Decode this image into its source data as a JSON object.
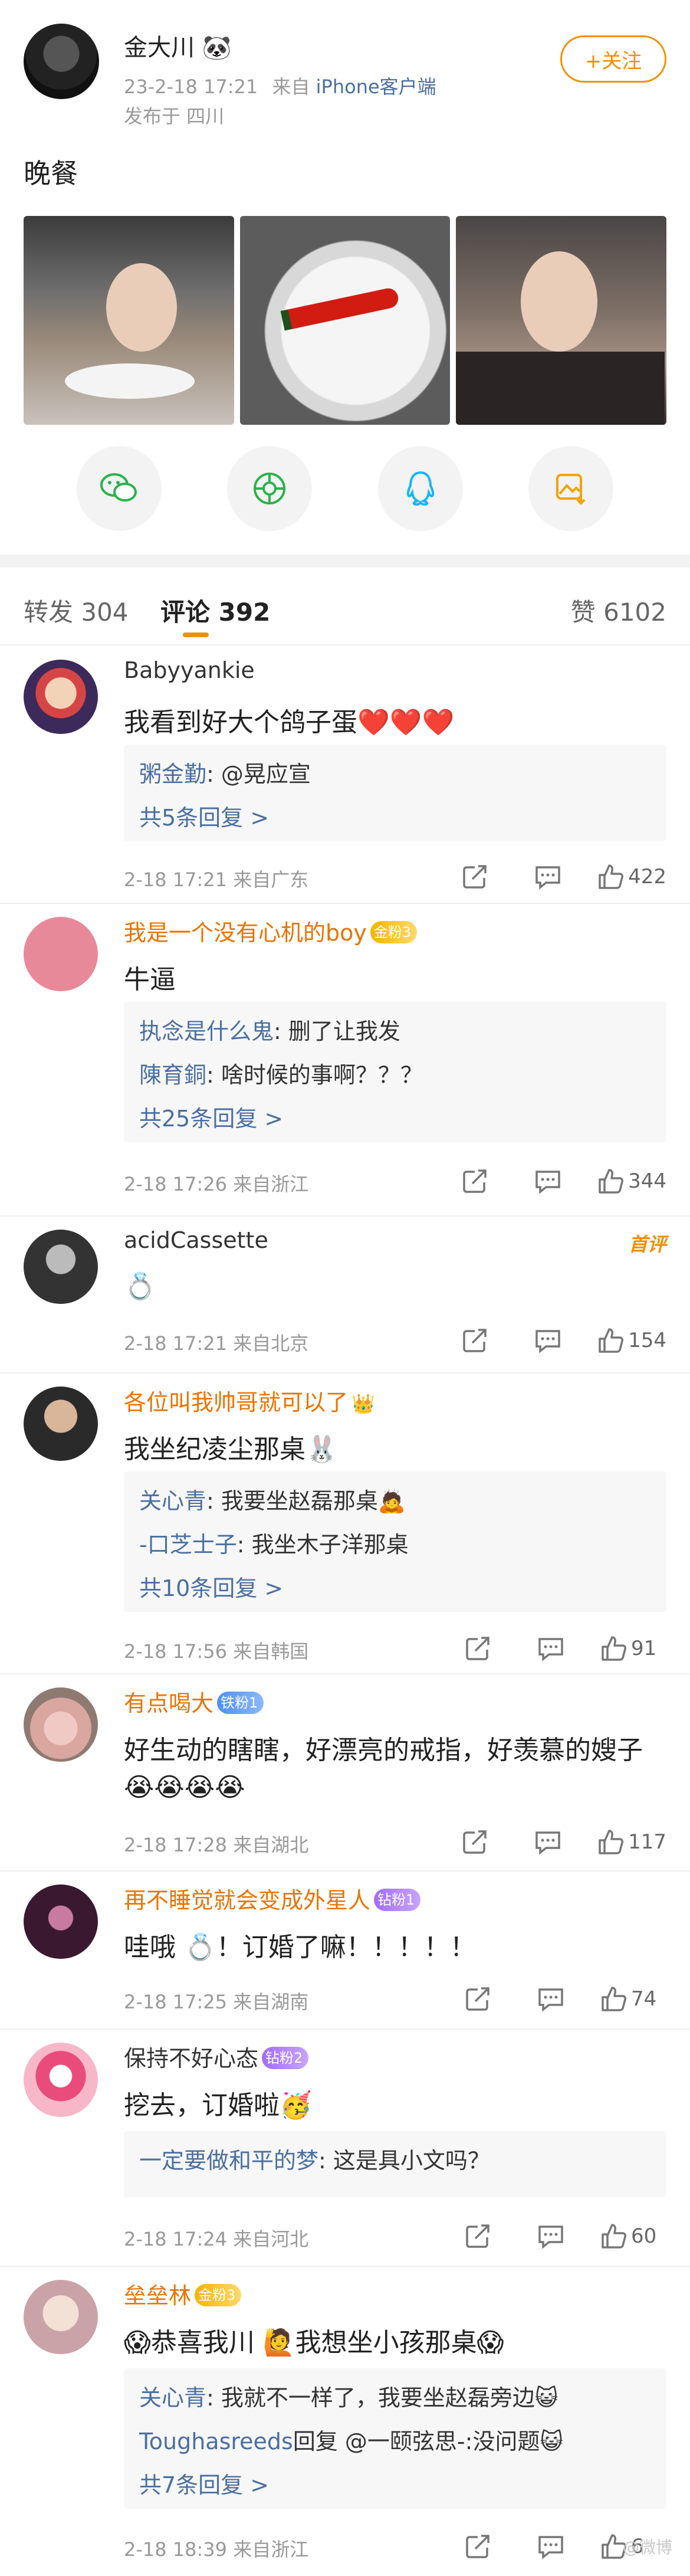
{
  "post": {
    "author_name": "金大川 🐼",
    "date": "23-2-18 17:21",
    "source_prefix": "来自",
    "source": "iPhone客户端",
    "location": "发布于 四川",
    "follow_label": "+关注",
    "text": "晚餐"
  },
  "tabs": {
    "repost": "转发 304",
    "comments": "评论 392",
    "likes": "赞 6102"
  },
  "comments": [
    {
      "name": "Babyyankie",
      "text": "我看到好大个鸽子蛋❤️❤️❤️",
      "replies": [
        {
          "who": "粥金勤",
          "text": ": @晃应宣"
        }
      ],
      "more": "共5条回复 >",
      "time": "2-18 17:21 来自广东",
      "likes": "422"
    },
    {
      "name": "我是一个没有心机的boy",
      "badge": "金粉3",
      "text": "牛逼",
      "replies": [
        {
          "who": "执念是什么鬼",
          "text": ": 删了让我发"
        },
        {
          "who": "陳育銅",
          "text": ": 啥时候的事啊？？？"
        }
      ],
      "more": "共25条回复 >",
      "time": "2-18 17:26 来自浙江",
      "likes": "344"
    },
    {
      "name": "acidCassette",
      "tag": "首评",
      "text": "💍",
      "time": "2-18 17:21 来自北京",
      "likes": "154"
    },
    {
      "name": "各位叫我帅哥就可以了",
      "badge": "👑",
      "text": "我坐纪凌尘那桌🐰",
      "replies": [
        {
          "who": "关心青",
          "text": ": 我要坐赵磊那桌🙇"
        },
        {
          "who": "-口芝士子",
          "text": ": 我坐木子洋那桌"
        }
      ],
      "more": "共10条回复 >",
      "time": "2-18 17:56 来自韩国",
      "likes": "91"
    },
    {
      "name": "有点喝大",
      "badge": "铁粉1",
      "text": "好生动的瞎瞎，好漂亮的戒指，好羡慕的嫂子",
      "text2": "😭😭😭😭",
      "time": "2-18 17:28 来自湖北",
      "likes": "117"
    },
    {
      "name": "再不睡觉就会变成外星人",
      "badge": "钻粉1",
      "text": "哇哦 💍！订婚了嘛！！！！！",
      "time": "2-18 17:25 来自湖南",
      "likes": "74"
    },
    {
      "name": "保持不好心态",
      "badge": "钻粉2",
      "text": "挖去，订婚啦🥳",
      "replies": [
        {
          "who": "一定要做和平的梦",
          "text": ": 这是具小文吗？"
        }
      ],
      "time": "2-18 17:24 来自河北",
      "likes": "60"
    },
    {
      "name": "垒垒林",
      "badge": "金粉3",
      "text": "😱恭喜我川 🙋我想坐小孩那桌😱",
      "replies": [
        {
          "who": "关心青",
          "text": ": 我就不一样了，我要坐赵磊旁边😺"
        },
        {
          "who": "Toughasreeds",
          "text": "回复 @一颐弦思-:没问题😺"
        }
      ],
      "more": "共7条回复 >",
      "time": "2-18 18:39 来自浙江",
      "likes": "6"
    }
  ],
  "icons": {
    "share": [
      "wechat-icon",
      "moments-icon",
      "qq-icon",
      "save-image-icon"
    ],
    "actions": [
      "forward-icon",
      "comment-icon",
      "like-icon"
    ]
  },
  "colors": {
    "accent": "#f28f00",
    "link": "#4a6fa1",
    "vip_name": "#eb7300"
  },
  "watermark": "@微博"
}
